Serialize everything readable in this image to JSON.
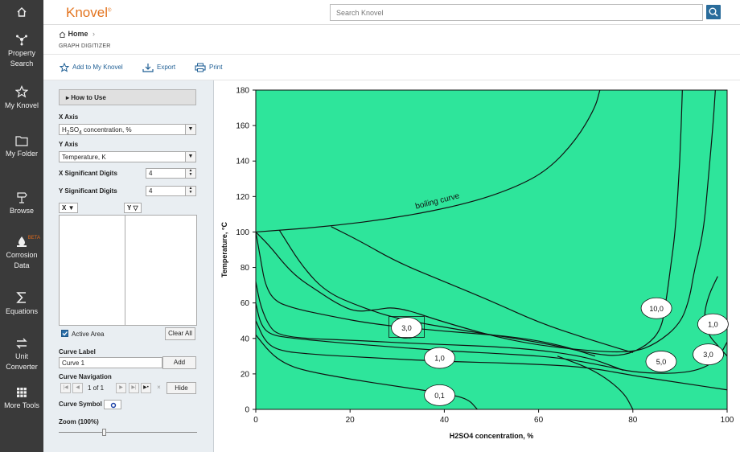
{
  "brand": "Knovel",
  "brand_mark": "®",
  "search": {
    "placeholder": "Search Knovel"
  },
  "breadcrumb": {
    "home": "Home",
    "chevron": "›"
  },
  "page_title": "GRAPH DIGITIZER",
  "toolbar": {
    "add": "Add to My Knovel",
    "export": "Export",
    "print": "Print"
  },
  "rail": [
    {
      "icon": "home-icon",
      "label": ""
    },
    {
      "icon": "property-search-icon",
      "label": "Property Search"
    },
    {
      "icon": "star-icon",
      "label": "My Knovel"
    },
    {
      "icon": "folder-icon",
      "label": "My Folder"
    },
    {
      "icon": "browse-icon",
      "label": "Browse"
    },
    {
      "icon": "corrosion-icon",
      "label": "Corrosion Data",
      "badge": "BETA"
    },
    {
      "icon": "sigma-icon",
      "label": "Equations"
    },
    {
      "icon": "unit-converter-icon",
      "label": "Unit Converter"
    },
    {
      "icon": "grid-icon",
      "label": "More Tools"
    }
  ],
  "panel": {
    "how_to_use": "How to Use",
    "x_axis_label": "X Axis",
    "x_axis_value": "H2SO4 concentration, %",
    "y_axis_label": "Y Axis",
    "y_axis_value": "Temperature, K",
    "x_sig_label": "X Significant Digits",
    "x_sig_value": "4",
    "y_sig_label": "Y Significant Digits",
    "y_sig_value": "4",
    "col_x": "X",
    "col_y": "Y",
    "active_area": "Active Area",
    "clear_all": "Clear All",
    "curve_label": "Curve Label",
    "curve_value": "Curve 1",
    "add": "Add",
    "curve_nav": "Curve Navigation",
    "page": "1 of 1",
    "hide": "Hide",
    "curve_symbol": "Curve Symbol",
    "zoom": "Zoom (100%)",
    "zoom_level": 0.33
  },
  "chart_data": {
    "type": "line",
    "xlabel": "H2SO4 concentration, %",
    "ylabel": "Temperature, °C",
    "xlim": [
      0,
      100
    ],
    "ylim": [
      0,
      180
    ],
    "xticks": [
      "0",
      "20",
      "40",
      "60",
      "80",
      "100"
    ],
    "yticks": [
      "0",
      "20",
      "40",
      "60",
      "80",
      "100",
      "120",
      "140",
      "160",
      "180"
    ],
    "fill_color": "#2ee59b",
    "annotation": "boiling curve",
    "series": [
      {
        "name": "boiling curve",
        "points": [
          [
            0,
            100
          ],
          [
            15,
            103
          ],
          [
            30,
            108
          ],
          [
            45,
            116
          ],
          [
            55,
            125
          ],
          [
            62,
            135
          ],
          [
            68,
            152
          ],
          [
            72,
            170
          ],
          [
            73,
            180
          ]
        ]
      },
      {
        "name": "",
        "points": [
          [
            0,
            100
          ],
          [
            3,
            92
          ],
          [
            6,
            82
          ],
          [
            9,
            74
          ],
          [
            13,
            67
          ],
          [
            17,
            60
          ],
          [
            21,
            55
          ],
          [
            25,
            56
          ],
          [
            30,
            58
          ],
          [
            40,
            49
          ],
          [
            55,
            38
          ],
          [
            70,
            33
          ],
          [
            80,
            32
          ],
          [
            85,
            37
          ],
          [
            90,
            48
          ],
          [
            92,
            62
          ],
          [
            93,
            78
          ],
          [
            95,
            100
          ],
          [
            96,
            130
          ],
          [
            97,
            160
          ],
          [
            97.5,
            180
          ]
        ]
      },
      {
        "name": "",
        "points": [
          [
            5,
            101
          ],
          [
            10,
            80
          ],
          [
            15,
            66
          ],
          [
            22,
            58
          ],
          [
            30,
            51
          ],
          [
            45,
            44
          ],
          [
            60,
            38
          ],
          [
            72,
            31
          ],
          [
            78,
            30
          ],
          [
            83,
            36
          ],
          [
            86,
            45
          ],
          [
            87,
            60
          ],
          [
            88,
            80
          ],
          [
            89,
            100
          ],
          [
            90,
            140
          ],
          [
            90.5,
            180
          ]
        ]
      },
      {
        "name": "",
        "points": [
          [
            16,
            103
          ],
          [
            22,
            95
          ],
          [
            30,
            83
          ],
          [
            40,
            72
          ],
          [
            50,
            61
          ],
          [
            60,
            49
          ],
          [
            70,
            40
          ],
          [
            80,
            32
          ]
        ]
      },
      {
        "name": "",
        "points": [
          [
            0,
            100
          ],
          [
            1,
            85
          ],
          [
            2,
            70
          ],
          [
            4,
            61
          ],
          [
            8,
            57
          ],
          [
            15,
            53
          ],
          [
            25,
            48
          ],
          [
            40,
            44
          ],
          [
            55,
            41
          ],
          [
            65,
            36
          ],
          [
            72,
            30
          ]
        ]
      },
      {
        "name": "",
        "points": [
          [
            0,
            72
          ],
          [
            1,
            58
          ],
          [
            3,
            46
          ],
          [
            5,
            42
          ],
          [
            10,
            40
          ],
          [
            20,
            39
          ],
          [
            35,
            37
          ],
          [
            55,
            35
          ],
          [
            70,
            30
          ],
          [
            78,
            22
          ]
        ]
      },
      {
        "name": "",
        "points": [
          [
            0,
            60
          ],
          [
            1,
            48
          ],
          [
            3,
            42
          ],
          [
            8,
            40
          ],
          [
            20,
            37
          ],
          [
            40,
            33
          ],
          [
            55,
            31
          ],
          [
            65,
            29
          ],
          [
            75,
            24
          ],
          [
            80,
            21
          ],
          [
            88,
            20
          ],
          [
            94,
            22
          ],
          [
            98,
            28
          ],
          [
            100,
            38
          ]
        ]
      },
      {
        "name": "",
        "points": [
          [
            0,
            50
          ],
          [
            2,
            38
          ],
          [
            5,
            33
          ],
          [
            12,
            31
          ],
          [
            25,
            29
          ],
          [
            40,
            27
          ],
          [
            55,
            26
          ],
          [
            70,
            24
          ],
          [
            80,
            19
          ],
          [
            90,
            15
          ],
          [
            100,
            11
          ]
        ]
      },
      {
        "name": "",
        "points": [
          [
            0,
            42
          ],
          [
            3,
            32
          ],
          [
            6,
            26
          ],
          [
            10,
            22
          ],
          [
            20,
            17
          ],
          [
            30,
            13
          ],
          [
            40,
            9
          ],
          [
            45,
            6
          ],
          [
            47,
            0
          ]
        ]
      },
      {
        "name": "",
        "points": [
          [
            64,
            30
          ],
          [
            72,
            22
          ],
          [
            78,
            10
          ],
          [
            80,
            0
          ]
        ]
      },
      {
        "name": "",
        "points": [
          [
            100,
            30
          ],
          [
            98,
            36
          ],
          [
            96,
            42
          ],
          [
            95,
            52
          ],
          [
            96,
            64
          ],
          [
            98,
            75
          ]
        ]
      }
    ],
    "labels": [
      {
        "text": "10,0",
        "x": 85,
        "y": 57
      },
      {
        "text": "3,0",
        "x": 32,
        "y": 46
      },
      {
        "text": "1,0",
        "x": 39,
        "y": 29
      },
      {
        "text": "5,0",
        "x": 86,
        "y": 27
      },
      {
        "text": "0,1",
        "x": 39,
        "y": 8
      },
      {
        "text": "1,0",
        "x": 97,
        "y": 48
      },
      {
        "text": "3,0",
        "x": 96,
        "y": 31
      }
    ]
  }
}
